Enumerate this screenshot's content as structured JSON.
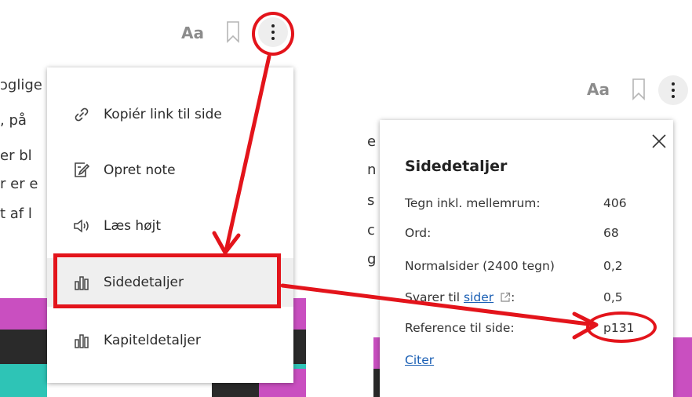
{
  "background_text": {
    "left_lines": [
      "ɔglige",
      ", på",
      "er bl",
      "r er e",
      "t af l"
    ],
    "right_lines": [
      "e",
      "n",
      "s",
      "c",
      "g"
    ]
  },
  "toolbar_left": {
    "font_label": "Aa",
    "bookmark_icon": "bookmark-icon",
    "more_icon": "more-vertical-icon"
  },
  "toolbar_right": {
    "font_label": "Aa",
    "bookmark_icon": "bookmark-icon",
    "more_icon": "more-vertical-icon"
  },
  "menu": {
    "items": [
      {
        "label": "Kopiér link til side",
        "icon": "link-icon"
      },
      {
        "label": "Opret note",
        "icon": "note-edit-icon"
      },
      {
        "label": "Læs højt",
        "icon": "speaker-icon"
      },
      {
        "label": "Sidedetaljer",
        "icon": "bar-chart-icon"
      },
      {
        "label": "Kapiteldetaljer",
        "icon": "bar-chart-icon"
      }
    ]
  },
  "panel": {
    "title": "Sidedetaljer",
    "close_icon": "close-icon",
    "rows": [
      {
        "label": "Tegn inkl. mellemrum:",
        "value": "406"
      },
      {
        "label": "Ord:",
        "value": "68"
      },
      {
        "label": "Normalsider (2400 tegn)",
        "value": "0,2"
      },
      {
        "label_prefix": "Svarer til ",
        "label_link": "sider",
        "label_suffix": ":",
        "value": "0,5",
        "icon": "external-link-icon"
      },
      {
        "label": "Reference til side:",
        "value": "p131"
      }
    ],
    "cite_label": "Citer"
  },
  "colors": {
    "annotation_red": "#e3141b",
    "link_blue": "#1a5fb4",
    "art_magenta": "#c94fc0",
    "art_teal": "#2ec4b6",
    "art_dark": "#2a2a2a"
  }
}
